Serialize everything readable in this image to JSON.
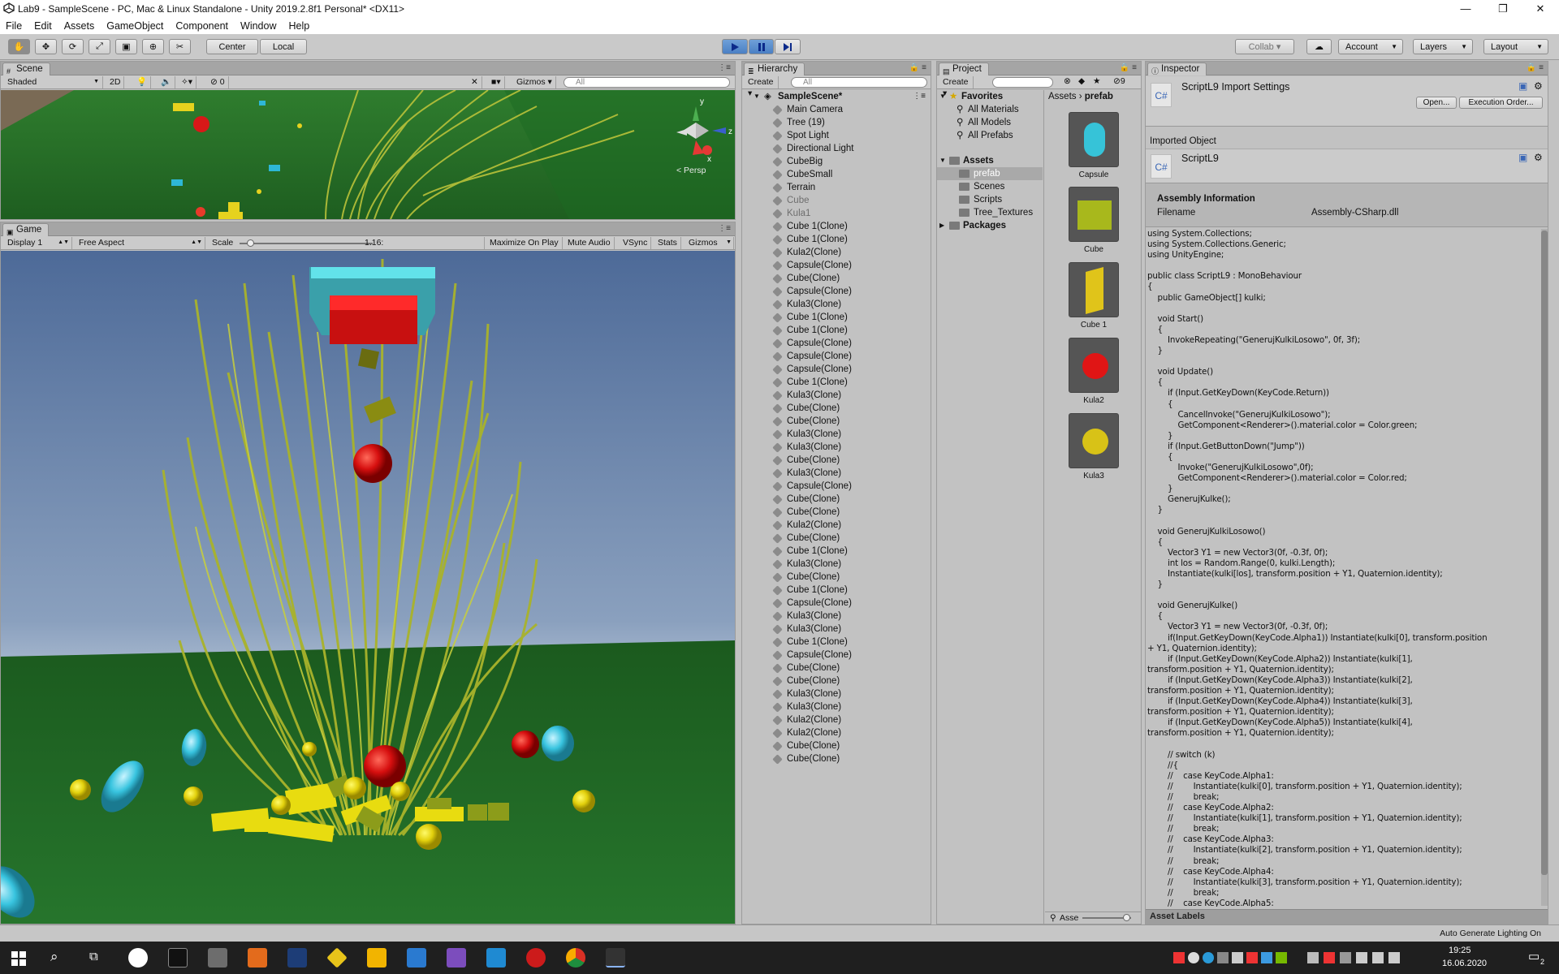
{
  "window": {
    "title": "Lab9 - SampleScene - PC, Mac & Linux Standalone - Unity 2019.2.8f1 Personal* <DX11>",
    "min": "—",
    "max": "❐",
    "close": "✕"
  },
  "menu": [
    "File",
    "Edit",
    "Assets",
    "GameObject",
    "Component",
    "Window",
    "Help"
  ],
  "toolbar": {
    "center": "Center",
    "local": "Local",
    "collab": "Collab ▾",
    "account": "Account",
    "layers": "Layers",
    "layout": "Layout"
  },
  "scene": {
    "tab": "Scene",
    "shading": "Shaded",
    "mode2d": "2D",
    "fx_count": "0",
    "gizmos": "Gizmos",
    "search": "All",
    "persp": "< Persp",
    "gizmo_axes": {
      "y": "y",
      "x": "x",
      "z": "z"
    }
  },
  "game": {
    "tab": "Game",
    "display": "Display 1",
    "aspect": "Free Aspect",
    "scale_label": "Scale",
    "scale_value": "1.16:",
    "scale_level": 0.08,
    "maximize": "Maximize On Play",
    "mute": "Mute Audio",
    "vsync": "VSync",
    "stats": "Stats",
    "gizmos": "Gizmos"
  },
  "hierarchy": {
    "tab": "Hierarchy",
    "create": "Create ▾",
    "search": "All",
    "scene": "SampleScene*",
    "items": [
      "Main Camera",
      "Tree (19)",
      "Spot Light",
      "Directional Light",
      "CubeBig",
      "CubeSmall",
      "Terrain",
      "Cube",
      "Kula1",
      "Cube 1(Clone)",
      "Cube 1(Clone)",
      "Kula2(Clone)",
      "Capsule(Clone)",
      "Cube(Clone)",
      "Capsule(Clone)",
      "Kula3(Clone)",
      "Cube 1(Clone)",
      "Cube 1(Clone)",
      "Capsule(Clone)",
      "Capsule(Clone)",
      "Capsule(Clone)",
      "Cube 1(Clone)",
      "Kula3(Clone)",
      "Cube(Clone)",
      "Cube(Clone)",
      "Kula3(Clone)",
      "Kula3(Clone)",
      "Cube(Clone)",
      "Kula3(Clone)",
      "Capsule(Clone)",
      "Cube(Clone)",
      "Cube(Clone)",
      "Kula2(Clone)",
      "Cube(Clone)",
      "Cube 1(Clone)",
      "Kula3(Clone)",
      "Cube(Clone)",
      "Cube 1(Clone)",
      "Capsule(Clone)",
      "Kula3(Clone)",
      "Kula3(Clone)",
      "Cube 1(Clone)",
      "Capsule(Clone)",
      "Cube(Clone)",
      "Cube(Clone)",
      "Kula3(Clone)",
      "Kula3(Clone)",
      "Kula2(Clone)",
      "Kula2(Clone)",
      "Cube(Clone)",
      "Cube(Clone)"
    ],
    "inactive": [
      7,
      8
    ]
  },
  "project": {
    "tab": "Project",
    "create": "Create ▾",
    "hidden_count": "9",
    "favorites": "Favorites",
    "fav_items": [
      "All Materials",
      "All Models",
      "All Prefabs"
    ],
    "assets": "Assets",
    "asset_folders": [
      "prefab",
      "Scenes",
      "Scripts",
      "Tree_Textures"
    ],
    "packages": "Packages",
    "breadcrumb_root": "Assets",
    "breadcrumb_leaf": "prefab",
    "prefabs": [
      {
        "name": "Capsule",
        "color": "#36c3d8"
      },
      {
        "name": "Cube",
        "color": "#a8b81c"
      },
      {
        "name": "Cube 1",
        "color": "#e0c41a"
      },
      {
        "name": "Kula2",
        "color": "#e01515"
      },
      {
        "name": "Kula3",
        "color": "#d8c217"
      }
    ],
    "footer_label": "Asse"
  },
  "inspector": {
    "tab": "Inspector",
    "header": "ScriptL9 Import Settings",
    "open": "Open...",
    "exec_order": "Execution Order...",
    "imported_object": "Imported Object",
    "script_name": "ScriptL9",
    "cs_icon": "C#",
    "assembly_title": "Assembly Information",
    "filename_label": "Filename",
    "filename_value": "Assembly-CSharp.dll",
    "asset_labels": "Asset Labels",
    "code": [
      "using System.Collections;",
      "using System.Collections.Generic;",
      "using UnityEngine;",
      "",
      "public class ScriptL9 : MonoBehaviour",
      "{",
      "    public GameObject[] kulki;",
      "",
      "    void Start()",
      "    {",
      "        InvokeRepeating(\"GenerujKulkiLosowo\", 0f, 3f);",
      "    }",
      "",
      "    void Update()",
      "    {",
      "        if (Input.GetKeyDown(KeyCode.Return))",
      "        {",
      "            CancelInvoke(\"GenerujKulkiLosowo\");",
      "            GetComponent<Renderer>().material.color = Color.green;",
      "        }",
      "        if (Input.GetButtonDown(\"Jump\"))",
      "        {",
      "            Invoke(\"GenerujKulkiLosowo\",0f);",
      "            GetComponent<Renderer>().material.color = Color.red;",
      "        }",
      "        GenerujKulke();",
      "    }",
      "",
      "    void GenerujKulkiLosowo()",
      "    {",
      "        Vector3 Y1 = new Vector3(0f, -0.3f, 0f);",
      "        int los = Random.Range(0, kulki.Length);",
      "        Instantiate(kulki[los], transform.position + Y1, Quaternion.identity);",
      "    }",
      "",
      "    void GenerujKulke()",
      "    {",
      "        Vector3 Y1 = new Vector3(0f, -0.3f, 0f);",
      "        if(Input.GetKeyDown(KeyCode.Alpha1)) Instantiate(kulki[0], transform.position",
      "+ Y1, Quaternion.identity);",
      "        if (Input.GetKeyDown(KeyCode.Alpha2)) Instantiate(kulki[1],",
      "transform.position + Y1, Quaternion.identity);",
      "        if (Input.GetKeyDown(KeyCode.Alpha3)) Instantiate(kulki[2],",
      "transform.position + Y1, Quaternion.identity);",
      "        if (Input.GetKeyDown(KeyCode.Alpha4)) Instantiate(kulki[3],",
      "transform.position + Y1, Quaternion.identity);",
      "        if (Input.GetKeyDown(KeyCode.Alpha5)) Instantiate(kulki[4],",
      "transform.position + Y1, Quaternion.identity);",
      "",
      "        // switch (k)",
      "        //{",
      "        //    case KeyCode.Alpha1:",
      "        //        Instantiate(kulki[0], transform.position + Y1, Quaternion.identity);",
      "        //        break;",
      "        //    case KeyCode.Alpha2:",
      "        //        Instantiate(kulki[1], transform.position + Y1, Quaternion.identity);",
      "        //        break;",
      "        //    case KeyCode.Alpha3:",
      "        //        Instantiate(kulki[2], transform.position + Y1, Quaternion.identity);",
      "        //        break;",
      "        //    case KeyCode.Alpha4:",
      "        //        Instantiate(kulki[3], transform.position + Y1, Quaternion.identity);",
      "        //        break;",
      "        //    case KeyCode.Alpha5:"
    ]
  },
  "statusbar": {
    "right": "Auto Generate Lighting On"
  },
  "taskbar": {
    "time": "19:25",
    "date": "16.06.2020",
    "notif": "2"
  }
}
